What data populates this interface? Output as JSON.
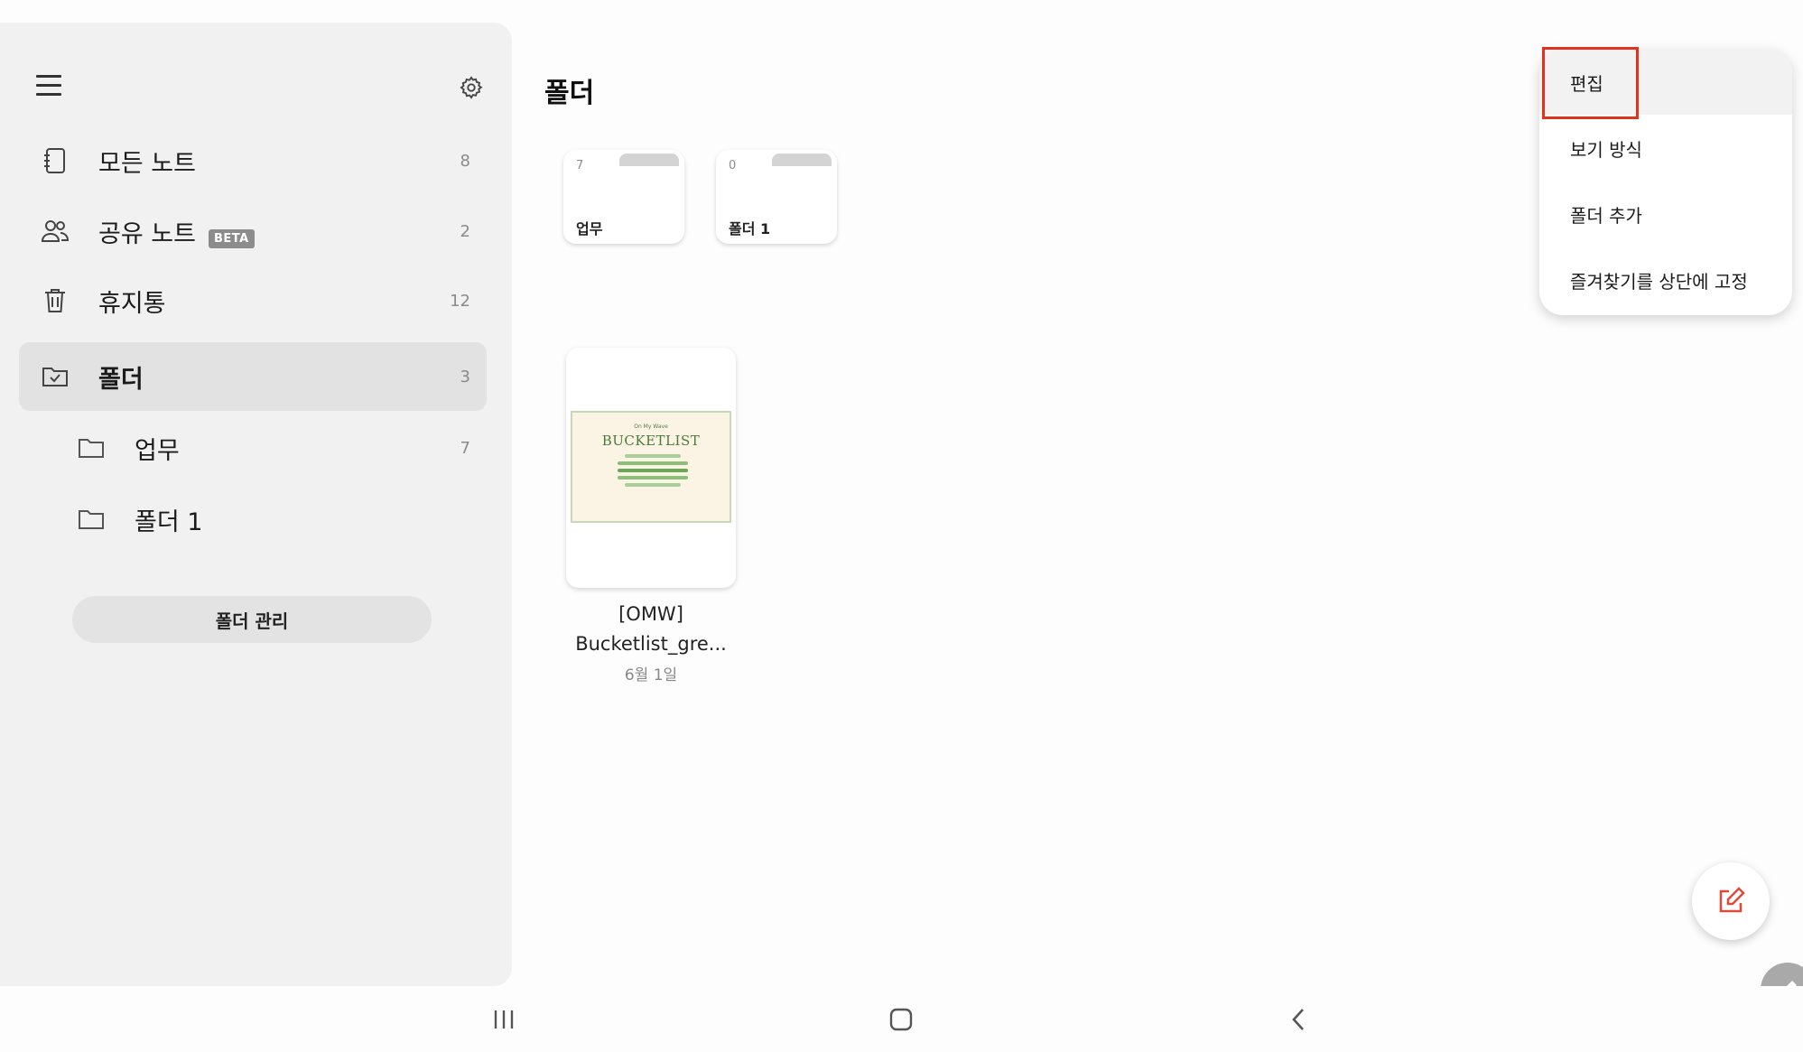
{
  "sidebar": {
    "items": [
      {
        "label": "모든 노트",
        "count": "8",
        "icon": "notebook-icon"
      },
      {
        "label": "공유 노트",
        "badge": "BETA",
        "count": "2",
        "icon": "people-icon"
      },
      {
        "label": "휴지통",
        "count": "12",
        "icon": "trash-icon"
      },
      {
        "label": "폴더",
        "count": "3",
        "icon": "folder-check-icon"
      },
      {
        "label": "업무",
        "count": "7",
        "icon": "folder-icon"
      },
      {
        "label": "폴더 1",
        "icon": "folder-icon"
      }
    ],
    "manage_button": "폴더 관리"
  },
  "main": {
    "title": "폴더",
    "folders": [
      {
        "count": "7",
        "name": "업무"
      },
      {
        "count": "0",
        "name": "폴더 1"
      }
    ],
    "note": {
      "thumb_small": "On My Wave",
      "thumb_title": "BUCKETLIST",
      "title_line1": "[OMW]",
      "title_line2": "Bucketlist_gre...",
      "date": "6월 1일"
    }
  },
  "menu": {
    "items": [
      "편집",
      "보기 방식",
      "폴더 추가",
      "즐겨찾기를 상단에 고정"
    ]
  },
  "colors": {
    "accent_red": "#e0321e",
    "fab_icon": "#e0493a",
    "thumb_green": "#4a7a38"
  }
}
